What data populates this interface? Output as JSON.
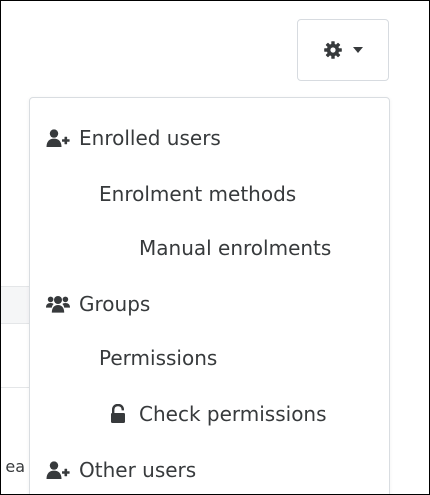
{
  "background": {
    "fragment_text": "ea"
  },
  "toolbar": {
    "gear_icon": "gear-icon",
    "caret_icon": "caret-down-icon"
  },
  "menu": {
    "items": [
      {
        "label": "Enrolled users",
        "icon": "user-plus-icon"
      },
      {
        "label": "Enrolment methods",
        "icon": ""
      },
      {
        "label": "Manual enrolments",
        "icon": ""
      },
      {
        "label": "Groups",
        "icon": "users-icon"
      },
      {
        "label": "Permissions",
        "icon": ""
      },
      {
        "label": "Check permissions",
        "icon": "unlock-icon"
      },
      {
        "label": "Other users",
        "icon": "user-plus-icon"
      }
    ]
  },
  "colors": {
    "text": "#373a3c",
    "border": "#d9dde1",
    "icon": "#373a3c"
  }
}
